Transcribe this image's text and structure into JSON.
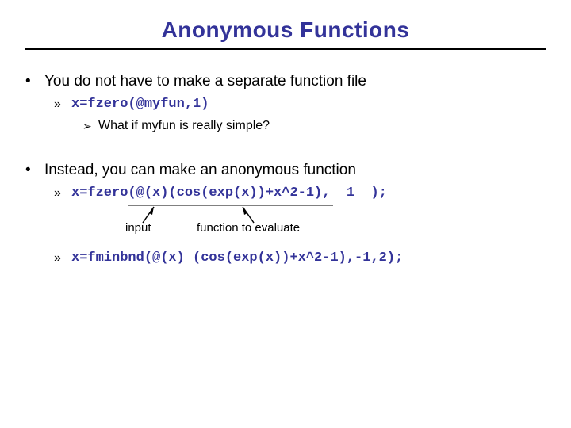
{
  "title": "Anonymous Functions",
  "bullets": {
    "b1a": "You do not have to make a separate function file",
    "code1": "x=fzero(@myfun,1)",
    "b3a": "What if myfun is really simple?",
    "b1b": "Instead, you can make an anonymous function",
    "code2": "x=fzero(@(x)(cos(exp(x))+x^2-1),  1  );",
    "code3": "x=fminbnd(@(x) (cos(exp(x))+x^2-1),-1,2);",
    "anno_input": "input",
    "anno_func": "function to evaluate"
  }
}
